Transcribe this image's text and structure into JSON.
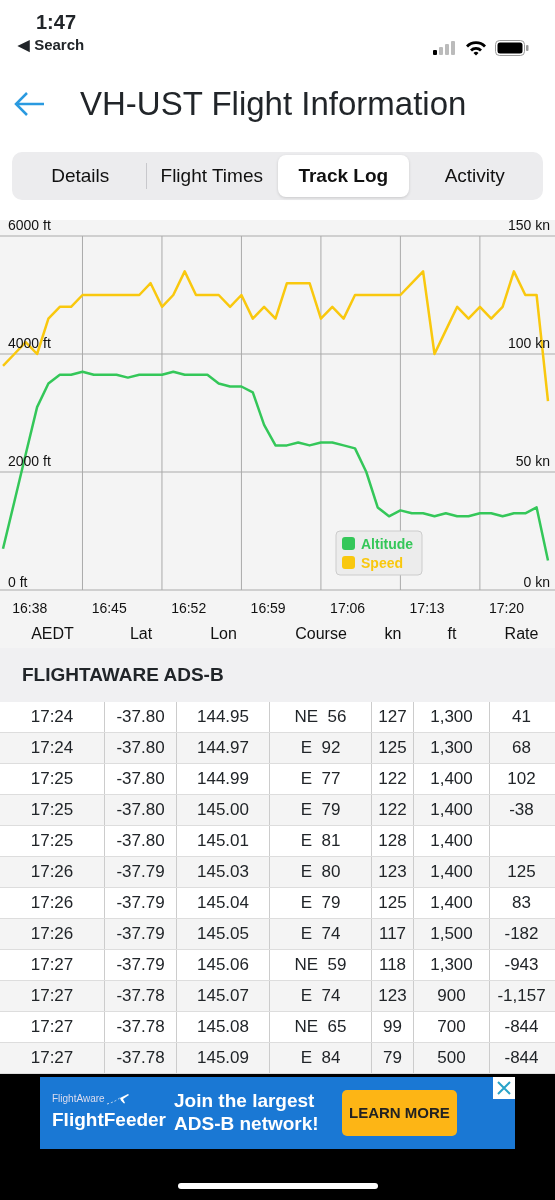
{
  "status_bar": {
    "time": "1:47",
    "back_label": "◀ Search"
  },
  "header": {
    "title": "VH-UST Flight Information"
  },
  "tabs": [
    {
      "label": "Details",
      "selected": false
    },
    {
      "label": "Flight Times",
      "selected": false
    },
    {
      "label": "Track Log",
      "selected": true
    },
    {
      "label": "Activity",
      "selected": false
    }
  ],
  "chart": {
    "chart_data": {
      "type": "line",
      "categories": [
        null,
        null,
        "16:38",
        null,
        null,
        null,
        null,
        null,
        null,
        "16:45",
        null,
        null,
        null,
        null,
        null,
        null,
        "16:52",
        null,
        null,
        null,
        null,
        null,
        null,
        "16:59",
        null,
        null,
        null,
        null,
        null,
        null,
        "17:06",
        null,
        null,
        null,
        null,
        null,
        null,
        "17:13",
        null,
        null,
        null,
        null,
        null,
        null,
        "17:20",
        null,
        null,
        null,
        null
      ],
      "legend": true,
      "ylim": [
        0,
        6000
      ],
      "yticks": [
        {
          "value": 0,
          "label": "0 ft"
        },
        {
          "value": 2000,
          "label": "2000 ft"
        },
        {
          "value": 4000,
          "label": "4000 ft"
        },
        {
          "value": 6000,
          "label": "6000 ft"
        }
      ],
      "y2lim": [
        0,
        150
      ],
      "y2ticks": [
        {
          "value": 0,
          "label": "0 kn"
        },
        {
          "value": 50,
          "label": "50 kn"
        },
        {
          "value": 100,
          "label": "100 kn"
        },
        {
          "value": 150,
          "label": "150 kn"
        }
      ],
      "series": [
        {
          "name": "Altitude",
          "color": "#34c759",
          "values": [
            700,
            1500,
            2300,
            3100,
            3500,
            3650,
            3650,
            3700,
            3650,
            3650,
            3650,
            3600,
            3650,
            3650,
            3650,
            3700,
            3650,
            3650,
            3650,
            3500,
            3450,
            3450,
            3350,
            2800,
            2450,
            2450,
            2500,
            2450,
            2500,
            2500,
            2450,
            2400,
            2000,
            1400,
            1250,
            1350,
            1300,
            1300,
            1250,
            1300,
            1250,
            1250,
            1300,
            1300,
            1250,
            1300,
            1300,
            1400,
            500
          ]
        },
        {
          "name": "Speed",
          "color": "#f9c80e",
          "axis": "y2",
          "values": [
            95,
            100,
            105,
            100,
            115,
            120,
            120,
            125,
            125,
            125,
            125,
            125,
            125,
            130,
            120,
            125,
            135,
            125,
            125,
            125,
            120,
            125,
            115,
            120,
            115,
            130,
            130,
            130,
            115,
            120,
            115,
            125,
            125,
            125,
            125,
            125,
            130,
            135,
            100,
            110,
            120,
            115,
            120,
            115,
            120,
            135,
            125,
            125,
            80
          ]
        }
      ]
    }
  },
  "table": {
    "columns": [
      "AEDT",
      "Lat",
      "Lon",
      "Course",
      "kn",
      "ft",
      "Rate"
    ],
    "section": "FLIGHTAWARE ADS-B",
    "rows": [
      [
        "17:24",
        "-37.80",
        "144.95",
        "NE  56",
        "127",
        "1,300",
        "41"
      ],
      [
        "17:24",
        "-37.80",
        "144.97",
        "E  92",
        "125",
        "1,300",
        "68"
      ],
      [
        "17:25",
        "-37.80",
        "144.99",
        "E  77",
        "122",
        "1,400",
        "102"
      ],
      [
        "17:25",
        "-37.80",
        "145.00",
        "E  79",
        "122",
        "1,400",
        "-38"
      ],
      [
        "17:25",
        "-37.80",
        "145.01",
        "E  81",
        "128",
        "1,400",
        ""
      ],
      [
        "17:26",
        "-37.79",
        "145.03",
        "E  80",
        "123",
        "1,400",
        "125"
      ],
      [
        "17:26",
        "-37.79",
        "145.04",
        "E  79",
        "125",
        "1,400",
        "83"
      ],
      [
        "17:26",
        "-37.79",
        "145.05",
        "E  74",
        "117",
        "1,500",
        "-182"
      ],
      [
        "17:27",
        "-37.79",
        "145.06",
        "NE  59",
        "118",
        "1,300",
        "-943"
      ],
      [
        "17:27",
        "-37.78",
        "145.07",
        "E  74",
        "123",
        "900",
        "-1,157"
      ],
      [
        "17:27",
        "-37.78",
        "145.08",
        "NE  65",
        "99",
        "700",
        "-844"
      ],
      [
        "17:27",
        "-37.78",
        "145.09",
        "E  84",
        "79",
        "500",
        "-844"
      ]
    ]
  },
  "ad": {
    "brand_small": "FlightAware",
    "brand": "FlightFeeder",
    "message": "Join the largest ADS-B network!",
    "button": "LEARN MORE"
  }
}
